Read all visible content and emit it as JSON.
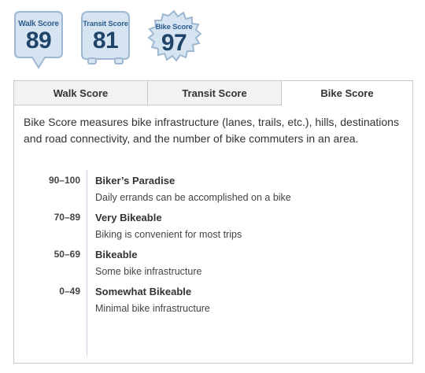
{
  "badges": {
    "walk": {
      "label": "Walk Score",
      "value": "89"
    },
    "transit": {
      "label": "Transit Score",
      "value": "81"
    },
    "bike": {
      "label": "Bike Score",
      "value": "97"
    }
  },
  "tabs": [
    {
      "label": "Walk Score",
      "active": false
    },
    {
      "label": "Transit Score",
      "active": false
    },
    {
      "label": "Bike Score",
      "active": true
    }
  ],
  "description": "Bike Score measures bike infrastructure (lanes, trails, etc.), hills, destinations and road connectivity, and the number of bike commuters in an area.",
  "ranges": [
    {
      "range": "90–100",
      "title": "Biker’s Paradise",
      "desc": "Daily errands can be accomplished on a bike"
    },
    {
      "range": "70–89",
      "title": "Very Bikeable",
      "desc": "Biking is convenient for most trips"
    },
    {
      "range": "50–69",
      "title": "Bikeable",
      "desc": "Some bike infrastructure"
    },
    {
      "range": "0–49",
      "title": "Somewhat Bikeable",
      "desc": "Minimal bike infrastructure"
    }
  ],
  "colors": {
    "badge_fill": "#d6e4f2",
    "badge_stroke": "#9fb8d2",
    "badge_text": "#1f4469",
    "border": "#c9c9c9"
  }
}
